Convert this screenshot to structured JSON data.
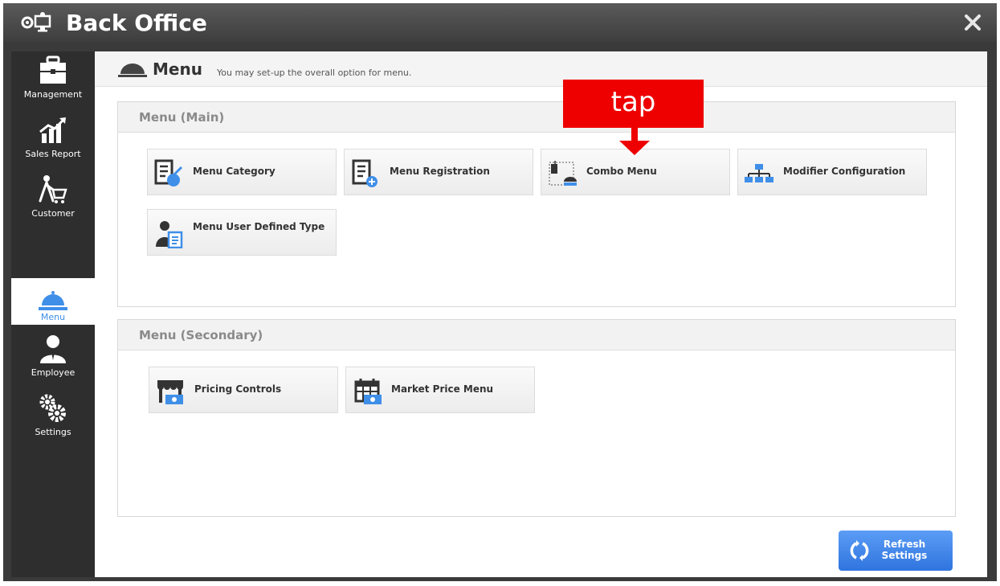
{
  "window": {
    "title": "Back Office"
  },
  "sidebar": {
    "items": [
      {
        "label": "Management",
        "icon": "briefcase-icon"
      },
      {
        "label": "Sales Report",
        "icon": "chart-icon"
      },
      {
        "label": "Customer",
        "icon": "customer-cart-icon"
      },
      {
        "label": "Menu",
        "icon": "cloche-icon",
        "active": true
      },
      {
        "label": "Employee",
        "icon": "employee-icon"
      },
      {
        "label": "Settings",
        "icon": "gears-icon"
      }
    ]
  },
  "header": {
    "title": "Menu",
    "description": "You may set-up the overall option for menu."
  },
  "sections": {
    "main": {
      "title": "Menu (Main)",
      "tiles": [
        {
          "label": "Menu Category",
          "icon": "menu-category-icon"
        },
        {
          "label": "Menu Registration",
          "icon": "menu-registration-icon"
        },
        {
          "label": "Combo Menu",
          "icon": "combo-menu-icon"
        },
        {
          "label": "Modifier Configuration",
          "icon": "modifier-hierarchy-icon"
        },
        {
          "label": "Menu User Defined Type",
          "icon": "user-defined-type-icon"
        }
      ]
    },
    "secondary": {
      "title": "Menu (Secondary)",
      "tiles": [
        {
          "label": "Pricing Controls",
          "icon": "store-price-icon"
        },
        {
          "label": "Market Price Menu",
          "icon": "calendar-price-icon"
        }
      ]
    }
  },
  "refresh_button": {
    "label": "Refresh Settings"
  },
  "annotation": {
    "label": "tap"
  },
  "colors": {
    "accent": "#3f8fe8",
    "annotation": "#ee0000",
    "sidebar": "#2e2e2e"
  }
}
